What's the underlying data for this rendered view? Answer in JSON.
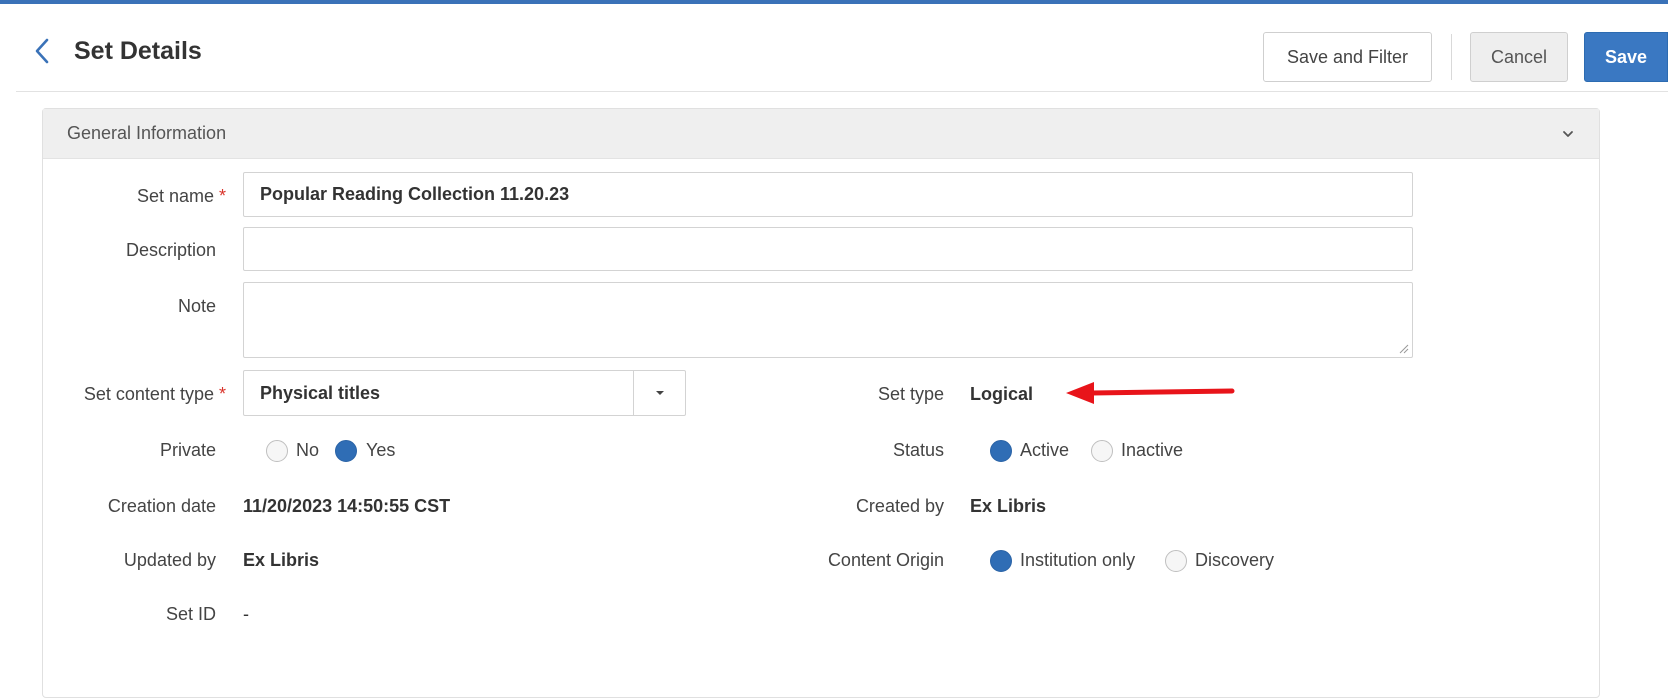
{
  "header": {
    "title": "Set Details",
    "save_filter_label": "Save and Filter",
    "cancel_label": "Cancel",
    "save_label": "Save"
  },
  "panel": {
    "title": "General Information"
  },
  "form": {
    "set_name": {
      "label": "Set name",
      "required": "*",
      "value": "Popular Reading Collection 11.20.23"
    },
    "description": {
      "label": "Description",
      "value": ""
    },
    "note": {
      "label": "Note",
      "value": ""
    },
    "content_type": {
      "label": "Set content type",
      "required": "*",
      "value": "Physical titles"
    },
    "set_type": {
      "label": "Set type",
      "value": "Logical"
    },
    "private": {
      "label": "Private",
      "options": [
        "No",
        "Yes"
      ],
      "selected": "Yes"
    },
    "status": {
      "label": "Status",
      "options": [
        "Active",
        "Inactive"
      ],
      "selected": "Active"
    },
    "creation_date": {
      "label": "Creation date",
      "value": "11/20/2023 14:50:55 CST"
    },
    "created_by": {
      "label": "Created by",
      "value": "Ex Libris"
    },
    "updated_by": {
      "label": "Updated by",
      "value": "Ex Libris"
    },
    "content_origin": {
      "label": "Content Origin",
      "options": [
        "Institution only",
        "Discovery"
      ],
      "selected": "Institution only"
    },
    "set_id": {
      "label": "Set ID",
      "value": "-"
    }
  },
  "colors": {
    "accent": "#3a78c2",
    "required": "#d9342b",
    "annotation_arrow": "#e8141a"
  },
  "icons": [
    "chevron-left-icon",
    "chevron-down-icon",
    "caret-down-icon",
    "resize-handle-icon",
    "annotation-arrow"
  ]
}
